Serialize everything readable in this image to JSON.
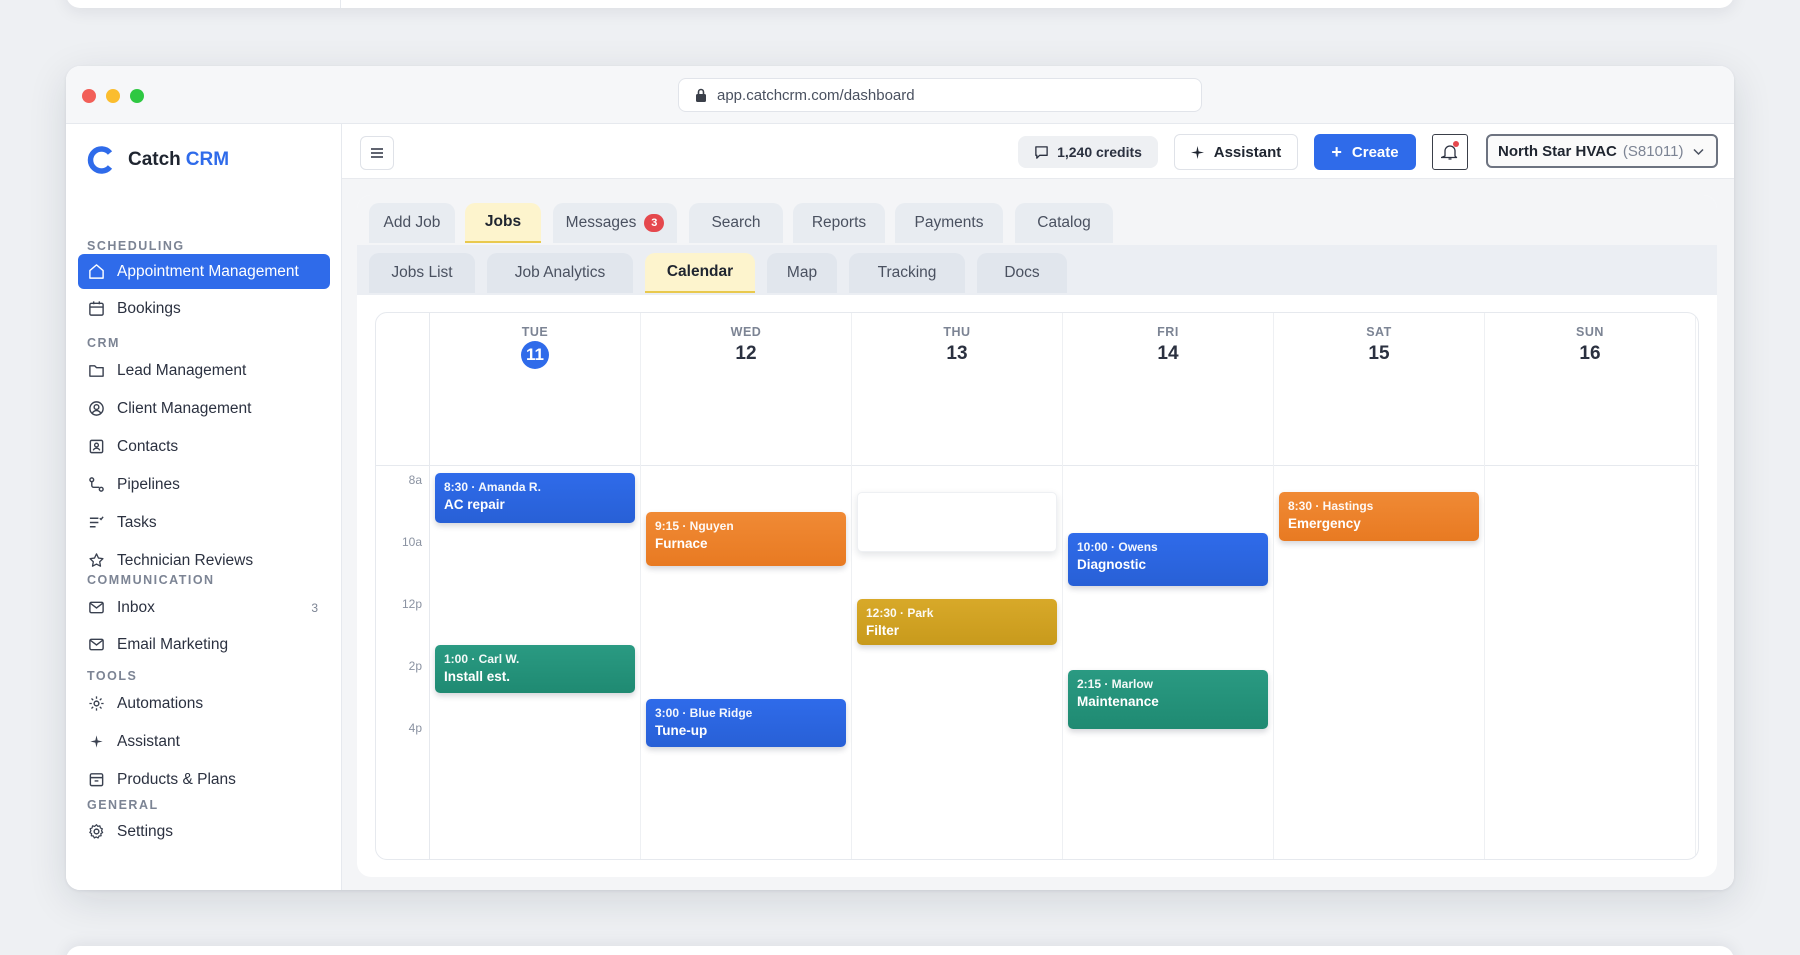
{
  "browser": {
    "url": "app.catchcrm.com/dashboard"
  },
  "brand": {
    "name": "Catch",
    "accent": "CRM",
    "color": "#2f6bea"
  },
  "sidebar": {
    "sections": [
      {
        "title": "SCHEDULING",
        "items": [
          {
            "label": "Appointment Management",
            "icon": "home-icon",
            "active": true
          },
          {
            "label": "Bookings",
            "icon": "calendar-icon"
          }
        ]
      },
      {
        "title": "CRM",
        "items": [
          {
            "label": "Lead Management",
            "icon": "folder-icon"
          },
          {
            "label": "Client Management",
            "icon": "user-circle-icon"
          },
          {
            "label": "Contacts",
            "icon": "contact-card-icon"
          },
          {
            "label": "Pipelines",
            "icon": "pipeline-icon"
          },
          {
            "label": "Tasks",
            "icon": "tasks-icon"
          },
          {
            "label": "Technician Reviews",
            "icon": "star-icon"
          }
        ]
      },
      {
        "title": "COMMUNICATION",
        "items": [
          {
            "label": "Inbox",
            "icon": "mail-icon",
            "count": "3"
          },
          {
            "label": "Email Marketing",
            "icon": "mail-icon"
          }
        ]
      },
      {
        "title": "TOOLS",
        "items": [
          {
            "label": "Automations",
            "icon": "automation-icon"
          },
          {
            "label": "Assistant",
            "icon": "sparkle-icon"
          },
          {
            "label": "Products & Plans",
            "icon": "box-icon"
          }
        ]
      },
      {
        "title": "GENERAL",
        "items": [
          {
            "label": "Settings",
            "icon": "gear-icon"
          }
        ]
      }
    ]
  },
  "topbar": {
    "credits": "1,240 credits",
    "assistant": "Assistant",
    "create": "Create",
    "account_name": "North Star HVAC",
    "account_id": "(S81011)"
  },
  "tabs_primary": [
    {
      "label": "Add Job"
    },
    {
      "label": "Jobs",
      "active": true
    },
    {
      "label": "Messages",
      "badge": "3"
    },
    {
      "label": "Search"
    },
    {
      "label": "Reports"
    },
    {
      "label": "Payments"
    },
    {
      "label": "Catalog"
    }
  ],
  "tabs_secondary": [
    {
      "label": "Jobs List"
    },
    {
      "label": "Job Analytics"
    },
    {
      "label": "Calendar",
      "active": true
    },
    {
      "label": "Map"
    },
    {
      "label": "Tracking"
    },
    {
      "label": "Docs"
    }
  ],
  "calendar": {
    "days": [
      {
        "name": "TUE",
        "num": "11",
        "today": true
      },
      {
        "name": "WED",
        "num": "12"
      },
      {
        "name": "THU",
        "num": "13"
      },
      {
        "name": "FRI",
        "num": "14"
      },
      {
        "name": "SAT",
        "num": "15"
      },
      {
        "name": "SUN",
        "num": "16"
      }
    ],
    "hours": [
      "8a",
      "10a",
      "12p",
      "2p",
      "4p"
    ],
    "events": [
      {
        "day": 0,
        "time": "8:30 · Amanda R.",
        "title": "AC repair",
        "color": "blue",
        "start": 8.0,
        "end": 9.6
      },
      {
        "day": 0,
        "time": "1:00 · Carl W.",
        "title": "Install est.",
        "color": "green",
        "start": 13.55,
        "end": 15.1
      },
      {
        "day": 1,
        "time": "9:15 · Nguyen",
        "title": "Furnace",
        "color": "orange",
        "start": 9.25,
        "end": 11.0
      },
      {
        "day": 1,
        "time": "3:00 · Blue Ridge",
        "title": "Tune-up",
        "color": "blue",
        "start": 15.3,
        "end": 16.85
      },
      {
        "day": 2,
        "time": "",
        "title": "",
        "color": "blank",
        "start": 8.6,
        "end": 10.55
      },
      {
        "day": 2,
        "time": "12:30 · Park",
        "title": "Filter",
        "color": "gold",
        "start": 12.05,
        "end": 13.55
      },
      {
        "day": 3,
        "time": "10:00 · Owens",
        "title": "Diagnostic",
        "color": "blue",
        "start": 9.95,
        "end": 11.65
      },
      {
        "day": 3,
        "time": "2:15 · Marlow",
        "title": "Maintenance",
        "color": "green",
        "start": 14.35,
        "end": 16.25
      },
      {
        "day": 4,
        "time": "8:30 · Hastings",
        "title": "Emergency",
        "color": "orange",
        "start": 8.6,
        "end": 10.2
      }
    ]
  }
}
